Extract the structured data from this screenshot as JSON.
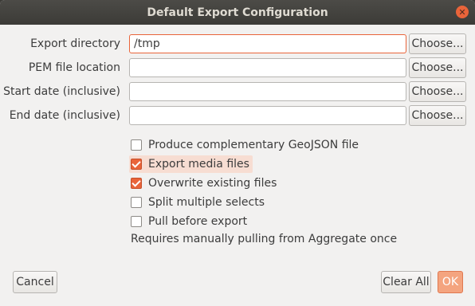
{
  "window": {
    "title": "Default Export Configuration"
  },
  "form": {
    "rows": [
      {
        "label": "Export directory",
        "value": "/tmp",
        "button": "Choose..."
      },
      {
        "label": "PEM file location",
        "value": "",
        "button": "Choose..."
      },
      {
        "label": "Start date (inclusive)",
        "value": "",
        "button": "Choose..."
      },
      {
        "label": "End date (inclusive)",
        "value": "",
        "button": "Choose..."
      }
    ]
  },
  "options": [
    {
      "label": "Produce complementary GeoJSON file",
      "checked": false
    },
    {
      "label": "Export media files",
      "checked": true
    },
    {
      "label": "Overwrite existing files",
      "checked": true
    },
    {
      "label": "Split multiple selects",
      "checked": false
    },
    {
      "label": "Pull before export",
      "checked": false
    }
  ],
  "note": "Requires manually pulling from Aggregate once",
  "buttons": {
    "cancel": "Cancel",
    "clear_all": "Clear All",
    "ok": "OK"
  },
  "colors": {
    "accent": "#e9643a",
    "titlebar": "#3c3b37",
    "background": "#f2f1f0"
  }
}
